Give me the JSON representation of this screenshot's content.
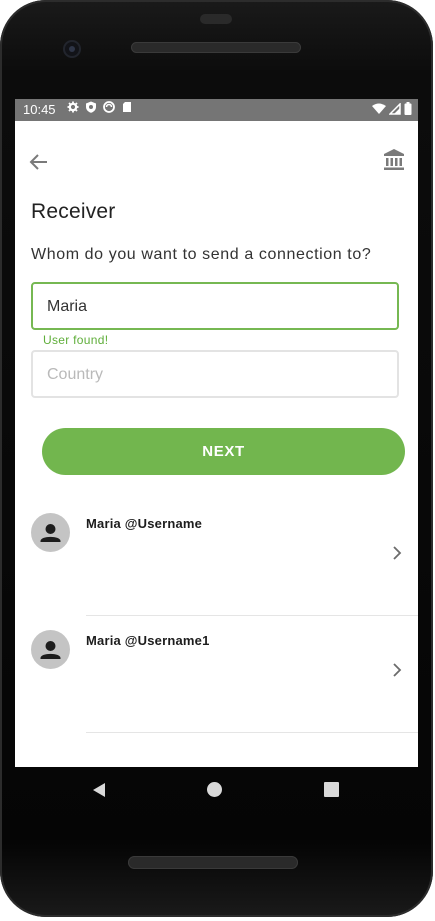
{
  "status_bar": {
    "time": "10:45",
    "icons": [
      "gear-icon",
      "shield-icon",
      "sync-icon",
      "sd-card-icon"
    ],
    "right_icons": [
      "wifi-icon",
      "signal-icon",
      "battery-icon"
    ]
  },
  "toolbar": {
    "back_icon": "arrow-left-icon",
    "bank_icon": "bank-icon"
  },
  "page": {
    "title": "Receiver",
    "question": "Whom do you want to send a connection to?"
  },
  "form": {
    "name_value": "Maria",
    "name_helper": "User found!",
    "country_value": "",
    "country_placeholder": "Country",
    "accent_color": "#76b852"
  },
  "next_button": {
    "label": "NEXT",
    "color": "#72b64e"
  },
  "results": [
    {
      "title": "Maria @Username"
    },
    {
      "title": "Maria @Username1"
    }
  ],
  "nav": {
    "back": "nav-back-icon",
    "home": "nav-home-icon",
    "recent": "nav-recent-icon"
  }
}
